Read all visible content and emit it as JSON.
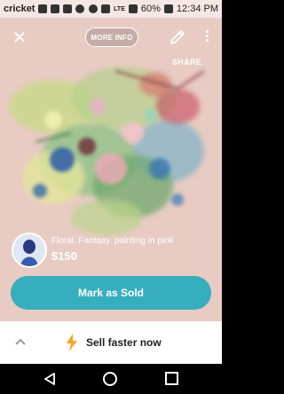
{
  "status_bar": {
    "carrier": "cricket",
    "network": "LTE",
    "battery_percent": "60%",
    "time": "12:34 PM"
  },
  "toolbar": {
    "close_icon": "close-icon",
    "more_info_label": "MORE INFO",
    "edit_icon": "pencil-icon",
    "more_icon": "kebab-menu-icon",
    "share_label": "SHARE"
  },
  "listing": {
    "title": "Floral. Fantasy.  painting in pink",
    "price": "$150"
  },
  "actions": {
    "mark_sold_label": "Mark as Sold",
    "sell_faster_label": "Sell faster now"
  },
  "colors": {
    "accent": "#36aebd",
    "bolt": "#f5a623"
  }
}
